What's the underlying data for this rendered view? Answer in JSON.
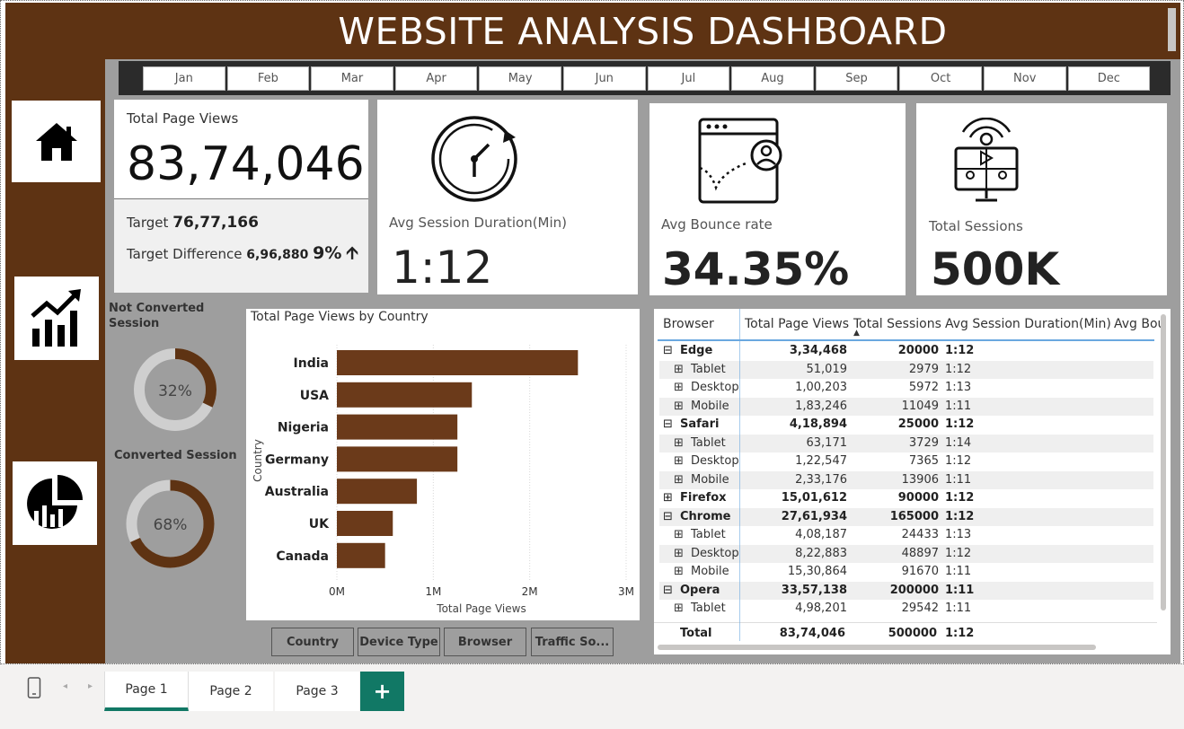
{
  "header": {
    "title": "WEBSITE ANALYSIS DASHBOARD"
  },
  "sidebar": {
    "items": [
      {
        "icon": "home-icon"
      },
      {
        "icon": "growth-chart-icon"
      },
      {
        "icon": "pie-bar-chart-icon"
      }
    ]
  },
  "months": [
    "Jan",
    "Feb",
    "Mar",
    "Apr",
    "May",
    "Jun",
    "Jul",
    "Aug",
    "Sep",
    "Oct",
    "Nov",
    "Dec"
  ],
  "kpi": {
    "page_views": {
      "label": "Total Page Views",
      "value": "83,74,046",
      "target_label": "Target",
      "target_value": "76,77,166",
      "diff_label": "Target Difference",
      "diff_value": "6,96,880",
      "diff_pct": "9%",
      "arrow": "🡩"
    },
    "session_duration": {
      "label": "Avg Session Duration(Min)",
      "value": "1:12",
      "icon": "stopwatch-icon"
    },
    "bounce_rate": {
      "label": "Avg Bounce rate",
      "value": "34.35%",
      "icon": "browser-user-icon"
    },
    "sessions": {
      "label": "Total Sessions",
      "value": "500K",
      "icon": "online-meeting-icon"
    }
  },
  "donuts": {
    "not_converted": {
      "label": "Not Converted Session",
      "value": "32%",
      "fraction": 0.32
    },
    "converted": {
      "label": "Converted Session",
      "value": "68%",
      "fraction": 0.68
    }
  },
  "chart_data": {
    "type": "bar",
    "orientation": "horizontal",
    "title": "Total Page Views by Country",
    "xlabel": "Total Page Views",
    "ylabel": "Country",
    "categories": [
      "India",
      "USA",
      "Nigeria",
      "Germany",
      "Australia",
      "UK",
      "Canada"
    ],
    "values": [
      2500000,
      1400000,
      1250000,
      1250000,
      830000,
      580000,
      500000
    ],
    "xlim": [
      0,
      3000000
    ],
    "xticks": [
      "0M",
      "1M",
      "2M",
      "3M"
    ],
    "grid": true,
    "color": "#6b3a1a"
  },
  "filters": [
    "Country",
    "Device Type",
    "Browser",
    "Traffic So..."
  ],
  "table": {
    "columns": [
      "Browser",
      "Total Page Views",
      "Total Sessions",
      "Avg Session Duration(Min)",
      "Avg Bou"
    ],
    "rows": [
      {
        "level": 0,
        "exp": "⊟",
        "name": "Edge",
        "views": "3,34,468",
        "sessions": "20000",
        "dur": "1:12"
      },
      {
        "level": 1,
        "exp": "⊞",
        "name": "Tablet",
        "views": "51,019",
        "sessions": "2979",
        "dur": "1:12"
      },
      {
        "level": 1,
        "exp": "⊞",
        "name": "Desktop",
        "views": "1,00,203",
        "sessions": "5972",
        "dur": "1:13"
      },
      {
        "level": 1,
        "exp": "⊞",
        "name": "Mobile",
        "views": "1,83,246",
        "sessions": "11049",
        "dur": "1:11"
      },
      {
        "level": 0,
        "exp": "⊟",
        "name": "Safari",
        "views": "4,18,894",
        "sessions": "25000",
        "dur": "1:12"
      },
      {
        "level": 1,
        "exp": "⊞",
        "name": "Tablet",
        "views": "63,171",
        "sessions": "3729",
        "dur": "1:14"
      },
      {
        "level": 1,
        "exp": "⊞",
        "name": "Desktop",
        "views": "1,22,547",
        "sessions": "7365",
        "dur": "1:12"
      },
      {
        "level": 1,
        "exp": "⊞",
        "name": "Mobile",
        "views": "2,33,176",
        "sessions": "13906",
        "dur": "1:11"
      },
      {
        "level": 0,
        "exp": "⊞",
        "name": "Firefox",
        "views": "15,01,612",
        "sessions": "90000",
        "dur": "1:12"
      },
      {
        "level": 0,
        "exp": "⊟",
        "name": "Chrome",
        "views": "27,61,934",
        "sessions": "165000",
        "dur": "1:12"
      },
      {
        "level": 1,
        "exp": "⊞",
        "name": "Tablet",
        "views": "4,08,187",
        "sessions": "24433",
        "dur": "1:13"
      },
      {
        "level": 1,
        "exp": "⊞",
        "name": "Desktop",
        "views": "8,22,883",
        "sessions": "48897",
        "dur": "1:12"
      },
      {
        "level": 1,
        "exp": "⊞",
        "name": "Mobile",
        "views": "15,30,864",
        "sessions": "91670",
        "dur": "1:11"
      },
      {
        "level": 0,
        "exp": "⊟",
        "name": "Opera",
        "views": "33,57,138",
        "sessions": "200000",
        "dur": "1:11"
      },
      {
        "level": 1,
        "exp": "⊞",
        "name": "Tablet",
        "views": "4,98,201",
        "sessions": "29542",
        "dur": "1:11"
      }
    ],
    "total": {
      "name": "Total",
      "views": "83,74,046",
      "sessions": "500000",
      "dur": "1:12"
    }
  },
  "pages": {
    "tabs": [
      "Page 1",
      "Page 2",
      "Page 3"
    ],
    "active": "Page 1",
    "add_label": "+"
  }
}
